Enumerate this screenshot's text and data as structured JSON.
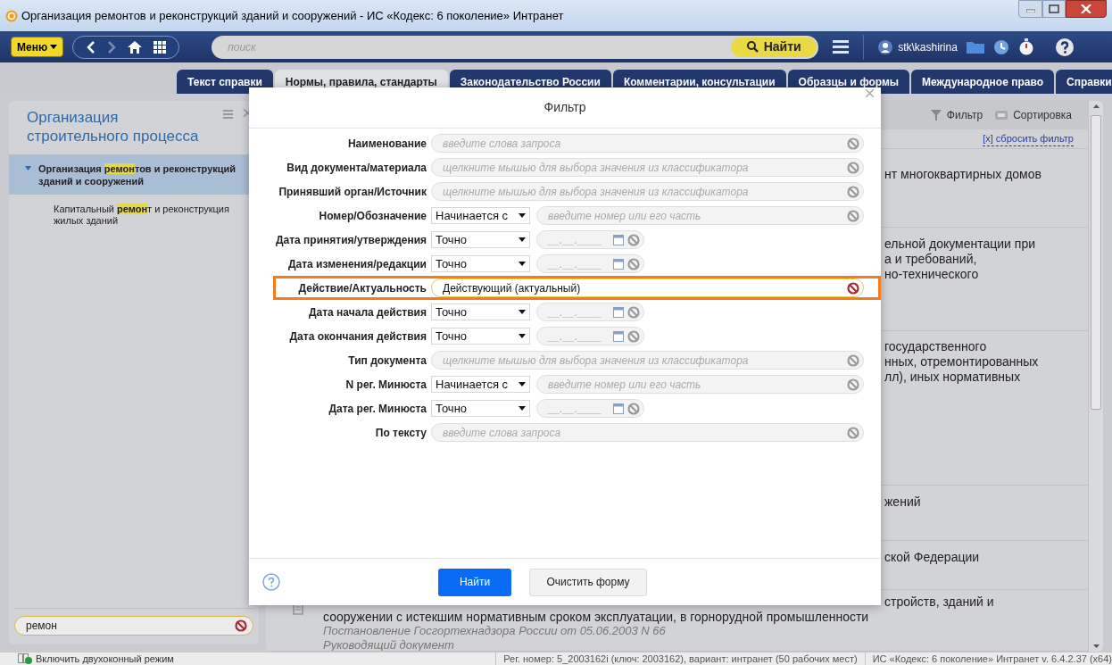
{
  "window": {
    "title": "Организация ремонтов и реконструкций зданий и сооружений - ИС «Кодекс: 6 поколение» Интранет"
  },
  "toolbar": {
    "menu_button": "Меню",
    "search": {
      "placeholder": "поиск"
    },
    "find_button": "Найти",
    "user": "stk\\kashirina"
  },
  "tabs": [
    {
      "label": "Текст справки",
      "selected": false
    },
    {
      "label": "Нормы, правила, стандарты",
      "selected": true
    },
    {
      "label": "Законодательство России",
      "selected": false
    },
    {
      "label": "Комментарии, консультации",
      "selected": false
    },
    {
      "label": "Образцы и формы",
      "selected": false
    },
    {
      "label": "Международное право",
      "selected": false
    },
    {
      "label": "Справки",
      "selected": false
    }
  ],
  "sidebar": {
    "title": "Организация строительного процесса",
    "search": {
      "value": "ремон"
    },
    "tree": [
      {
        "label": "Организация **ремон**тов и реконструкций зданий и сооружений",
        "expanded": true,
        "selected": true,
        "children": [
          {
            "label": "Капитальный **ремон**т и реконструкция жилых зданий",
            "selected": false
          }
        ]
      }
    ]
  },
  "results": {
    "filter_button": "Фильтр",
    "sort_button": "Сортировка",
    "reset_filter": "[x] сбросить фильтр",
    "items": [
      {
        "lines": [
          "нт многоквартирных домов"
        ]
      },
      {
        "lines": [
          "ельной документации при",
          "а и требований,",
          "но-технического"
        ]
      },
      {
        "lines": [
          "государственного",
          "нных, отремонтированных",
          "лл), иных нормативных"
        ]
      },
      {
        "lines": [
          "жений"
        ]
      },
      {
        "lines": [
          "ской Федерации"
        ]
      },
      {
        "lines": [
          "стройств, зданий и"
        ],
        "title": "сооружении с истекшим нормативным сроком эксплуатации, в горнорудной промышленности",
        "source": "Постановление Госгортехнадзора России от 05.06.2003 N 66",
        "doc_type": "Руководящий документ"
      }
    ]
  },
  "dialog": {
    "title": "Фильтр",
    "fields": [
      {
        "kind": "text",
        "label": "Наименование",
        "placeholder": "введите слова запроса",
        "highlighted": false
      },
      {
        "kind": "text",
        "label": "Вид документа/материала",
        "placeholder": "щелкните мышью для выбора значения из классификатора",
        "highlighted": false
      },
      {
        "kind": "text",
        "label": "Принявший орган/Источник",
        "placeholder": "щелкните мышью для выбора значения из классификатора",
        "highlighted": false
      },
      {
        "kind": "match",
        "label": "Номер/Обозначение",
        "mode": "Начинается с",
        "placeholder": "введите номер или его часть",
        "highlighted": false
      },
      {
        "kind": "date",
        "label": "Дата принятия/утверждения",
        "mode": "Точно",
        "placeholder": "__.__.____",
        "highlighted": false
      },
      {
        "kind": "date",
        "label": "Дата изменения/редакции",
        "mode": "Точно",
        "placeholder": "__.__.____",
        "highlighted": false
      },
      {
        "kind": "text",
        "label": "Действие/Актуальность",
        "value": "Действующий (актуальный)",
        "highlighted": true
      },
      {
        "kind": "date",
        "label": "Дата начала действия",
        "mode": "Точно",
        "placeholder": "__.__.____",
        "highlighted": false
      },
      {
        "kind": "date",
        "label": "Дата окончания действия",
        "mode": "Точно",
        "placeholder": "__.__.____",
        "highlighted": false
      },
      {
        "kind": "text",
        "label": "Тип документа",
        "placeholder": "щелкните мышью для выбора значения из классификатора",
        "highlighted": false
      },
      {
        "kind": "match",
        "label": "N рег. Минюста",
        "mode": "Начинается с",
        "placeholder": "введите номер или его часть",
        "highlighted": false
      },
      {
        "kind": "date",
        "label": "Дата рег. Минюста",
        "mode": "Точно",
        "placeholder": "__.__.____",
        "highlighted": false
      },
      {
        "kind": "text",
        "label": "По тексту",
        "placeholder": "введите слова запроса",
        "highlighted": false
      }
    ],
    "find_button": "Найти",
    "clear_button": "Очистить форму"
  },
  "status_bar": {
    "dual_mode": "Включить двухоконный режим",
    "registration": "Рег. номер: 5_2003162i (ключ: 2003162), вариант: интранет (50 рабочих мест)",
    "version": "ИС «Кодекс: 6 поколение» Интранет v. 6.4.2.37 (x64)"
  }
}
